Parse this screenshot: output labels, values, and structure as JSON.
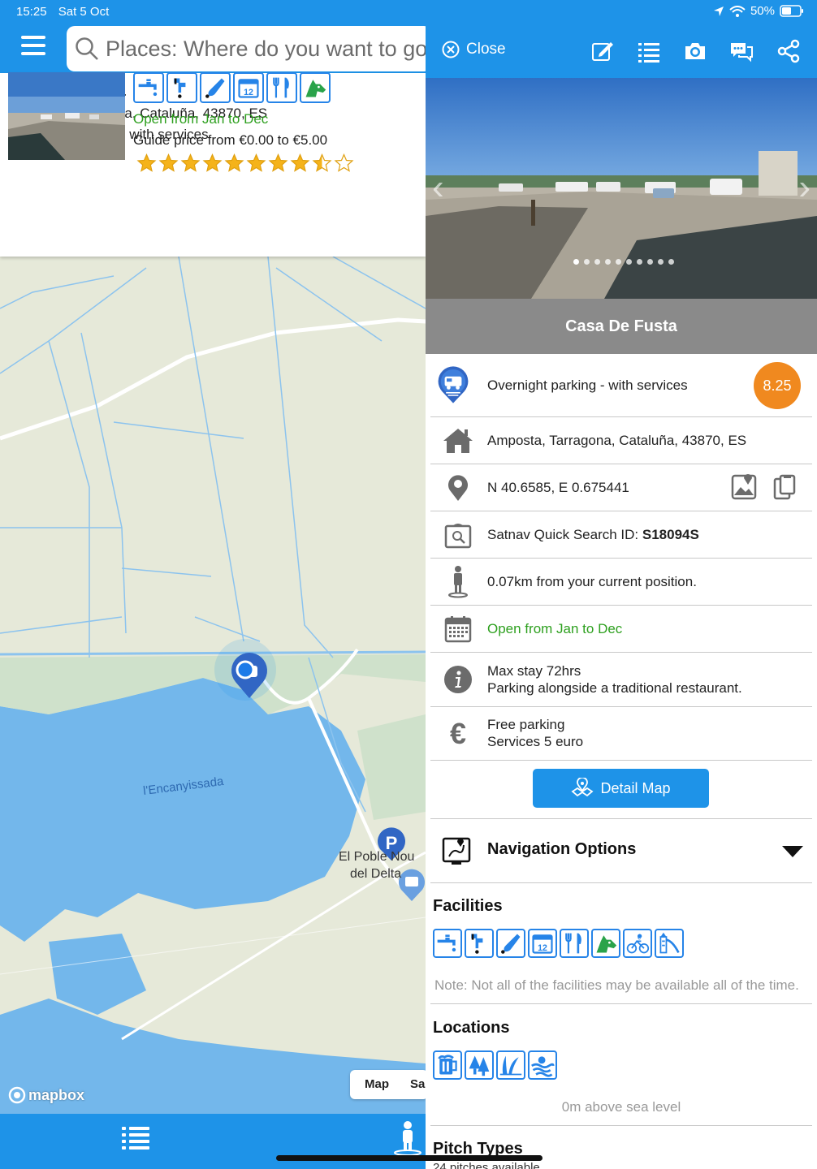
{
  "status": {
    "time": "15:25",
    "date": "Sat 5 Oct",
    "battery": "50%"
  },
  "search": {
    "placeholder": "Places: Where do you want to go"
  },
  "card": {
    "title": "Casa De Fusta",
    "address": "Amposta, Tarragona, Cataluña, 43870, ES",
    "type": "Overnight parking - with services",
    "open": "Open from Jan to Dec",
    "price": "Guide price from €0.00 to €5.00",
    "rating": 8.5,
    "rating_max": 10,
    "facility_icons": [
      "water-tap-icon",
      "waste-water-icon",
      "toilet-dump-icon",
      "calendar-icon",
      "restaurant-icon",
      "dog-icon"
    ]
  },
  "map": {
    "labels": {
      "lagoon": "l'Encanyissada",
      "town1": "El Poble Nou",
      "town2": "del Delta",
      "parking": "P"
    },
    "tabs": [
      "Map",
      "Sa"
    ],
    "attribution": "mapbox"
  },
  "detail": {
    "close_label": "Close",
    "name": "Casa De Fusta",
    "type": "Overnight parking - with services",
    "score": "8.25",
    "address": "Amposta, Tarragona, Cataluña, 43870, ES",
    "coords": "N 40.6585, E 0.675441",
    "satnav_prefix": "Satnav Quick Search ID: ",
    "satnav_id": "S18094S",
    "distance": "0.07km from your current position.",
    "open": "Open from Jan to Dec",
    "info_line1": "Max stay 72hrs",
    "info_line2": "Parking alongside a traditional restaurant.",
    "price_line1": "Free parking",
    "price_line2": "Services 5 euro",
    "detail_map_label": "Detail Map",
    "nav_options_label": "Navigation Options",
    "facilities_title": "Facilities",
    "facilities_icons": [
      "water-tap-icon",
      "waste-water-icon",
      "toilet-dump-icon",
      "calendar-icon",
      "restaurant-icon",
      "dog-icon",
      "cycling-icon",
      "playground-icon"
    ],
    "facilities_note": "Note: Not all of the facilities may be available all of the time.",
    "locations_title": "Locations",
    "locations_icons": [
      "beer-icon",
      "forest-icon",
      "wetland-icon",
      "lake-icon"
    ],
    "sea_level": "0m above sea level",
    "pitch_title": "Pitch Types",
    "pitch_sub": "24 pitches available"
  },
  "colors": {
    "accent": "#1e93e8",
    "score": "#f0891f",
    "open": "#2ea01f",
    "name_bar": "#8a8a8a"
  }
}
